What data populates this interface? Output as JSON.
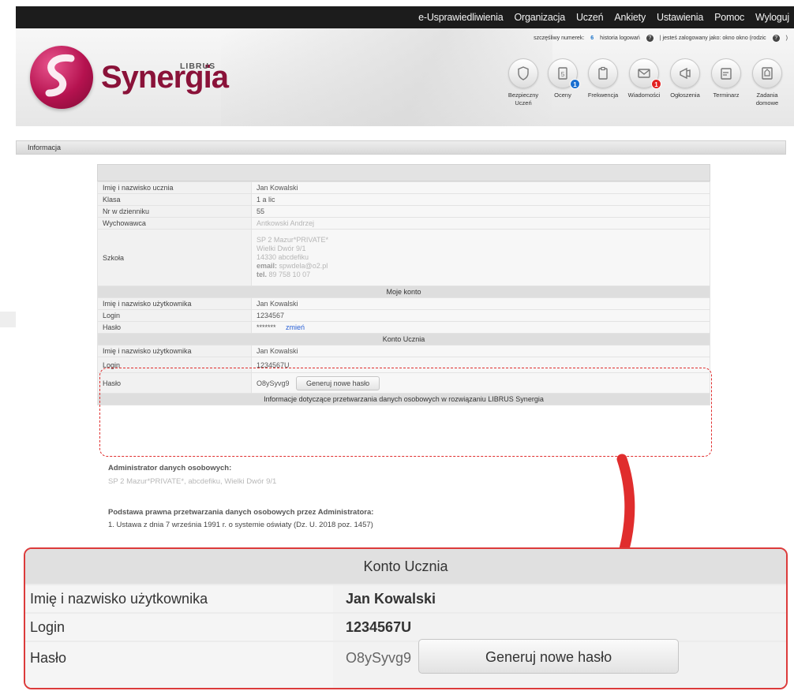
{
  "nav": {
    "items": [
      "e-Usprawiedliwienia",
      "Organizacja",
      "Uczeń",
      "Ankiety",
      "Ustawienia",
      "Pomoc",
      "Wyloguj"
    ]
  },
  "logo": {
    "brand": "Synergia",
    "sub": "LIBRUS"
  },
  "header_links": {
    "lucky_number_label": "szczęśliwy numerek:",
    "lucky_number": "6",
    "login_history": "historia logowań",
    "logged_in_as": "| jesteś zalogowany jako: okno okno (rodzic",
    "close_paren": ")"
  },
  "shortcuts": [
    {
      "label": "Bezpieczny Uczeń",
      "icon": "shield-icon"
    },
    {
      "label": "Oceny",
      "icon": "grades-icon",
      "badge": "1"
    },
    {
      "label": "Frekwencja",
      "icon": "clipboard-icon"
    },
    {
      "label": "Wiadomości",
      "icon": "envelope-icon",
      "badge": "1"
    },
    {
      "label": "Ogłoszenia",
      "icon": "megaphone-icon"
    },
    {
      "label": "Terminarz",
      "icon": "calendar-icon"
    },
    {
      "label": "Zadania domowe",
      "icon": "homework-icon"
    }
  ],
  "section_title": "Informacja",
  "student": {
    "name_label": "Imię i nazwisko ucznia",
    "name": "Jan Kowalski",
    "class_label": "Klasa",
    "class": "1 a lic",
    "number_label": "Nr w dzienniku",
    "number": "55",
    "tutor_label": "Wychowawca",
    "tutor": "Antkowski Andrzej",
    "school_label": "Szkoła",
    "school_lines": [
      "SP 2 Mazur*PRIVATE*",
      "Wielki Dwór 9/1",
      "14330 abcdefiku",
      "spwdela@o2.pl",
      "89 758 10 07"
    ],
    "email_prefix": "email:",
    "tel_prefix": "tel."
  },
  "my_account": {
    "title": "Moje konto",
    "user_label": "Imię i nazwisko użytkownika",
    "user": "Jan Kowalski",
    "login_label": "Login",
    "login": "1234567",
    "password_label": "Hasło",
    "password": "*******",
    "change_link": "zmień"
  },
  "student_account": {
    "title": "Konto Ucznia",
    "user_label": "Imię i nazwisko użytkownika",
    "user": "Jan Kowalski",
    "login_label": "Login",
    "login": "1234567U",
    "password_label": "Hasło",
    "password": "O8ySyvg9",
    "generate_button": "Generuj nowe hasło"
  },
  "gdpr": {
    "title": "Informacje dotyczące przetwarzania danych osobowych w rozwiązaniu LIBRUS Synergia",
    "admin_heading": "Administrator danych osobowych:",
    "admin_value": "SP 2 Mazur*PRIVATE*, abcdefiku, Wielki Dwór 9/1",
    "basis_heading": "Podstawa prawna przetwarzania danych osobowych przez Administratora:",
    "basis_item_1": "1. Ustawa z dnia 7 września 1991 r. o systemie oświaty (Dz. U. 2018 poz. 1457)"
  },
  "colors": {
    "brand": "#8a1239",
    "highlight": "#e02d2d",
    "link": "#2a61d6"
  }
}
